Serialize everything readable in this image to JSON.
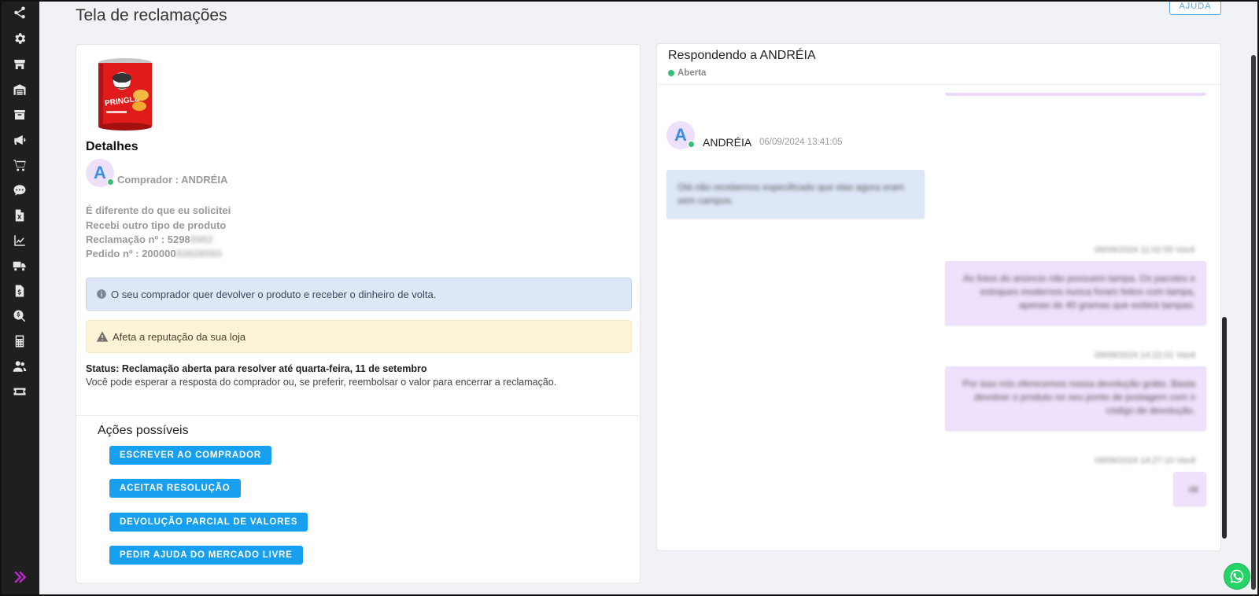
{
  "page": {
    "title": "Tela de reclamações",
    "help_label": "AJUDA"
  },
  "sidebar": {
    "icons": [
      "share-icon",
      "gear-icon",
      "store-icon",
      "warehouse-icon",
      "archive-icon",
      "megaphone-icon",
      "cart-icon",
      "chat-icon",
      "spreadsheet-icon",
      "chart-icon",
      "truck-icon",
      "invoice-icon",
      "search-icon",
      "calculator-icon",
      "users-icon",
      "ticket-icon"
    ],
    "expand_icon": "double-chevron-right-icon"
  },
  "details": {
    "title": "Detalhes",
    "avatar_letter": "A",
    "buyer_label": "Comprador : ANDRÉIA",
    "reason": "É diferente do que eu solicitei",
    "sub_reason": "Recebi outro tipo de produto",
    "claim_label": "Reclamação nº : 5298",
    "claim_hidden": "0982",
    "order_label": "Pedido nº : 200000",
    "order_hidden": "83928593",
    "info_alert": "O seu comprador quer devolver o produto e receber o dinheiro de volta.",
    "warn_alert": "Afeta a reputação da sua loja",
    "status_line": "Status: Reclamação aberta para resolver até quarta-feira, 11 de setembro",
    "status_sub": "Você pode esperar a resposta do comprador ou, se preferir, reembolsar o valor para encerrar a reclamação."
  },
  "actions": {
    "title": "Ações possíveis",
    "buttons": [
      "ESCREVER AO COMPRADOR",
      "ACEITAR RESOLUÇÃO",
      "DEVOLUÇÃO PARCIAL DE VALORES",
      "PEDIR AJUDA DO MERCADO LIVRE"
    ]
  },
  "chat": {
    "title": "Respondendo a ANDRÉIA",
    "status": "Aberta",
    "avatar_letter": "A",
    "buyer_name": "ANDRÉIA",
    "buyer_date": "06/09/2024 13:41:05",
    "messages": [
      {
        "from": "buyer",
        "text": "Olá não recebemos especificado que elas agora eram sem campos."
      },
      {
        "from": "seller",
        "meta": "09/09/2024 11:02:55 Você",
        "text": "As fotos do anúncio não possuem tampa. Os pacotes e estoques modernos nunca foram feitos com tampa, apenas de 40 gramas que exibirá tampas."
      },
      {
        "from": "seller",
        "meta": "09/09/2024 14:22:01 Você",
        "text": "Por isso nós oferecemos nossa devolução grátis. Basta devolver o produto no seu ponto de postagem com o código de devolução."
      },
      {
        "from": "seller",
        "meta": "09/09/2024 14:27:10 Você",
        "text": "ok"
      }
    ]
  },
  "colors": {
    "primary": "#18a0f0",
    "sidebar": "#1f1f1f",
    "online": "#35c07a",
    "expand": "#c026d3"
  }
}
